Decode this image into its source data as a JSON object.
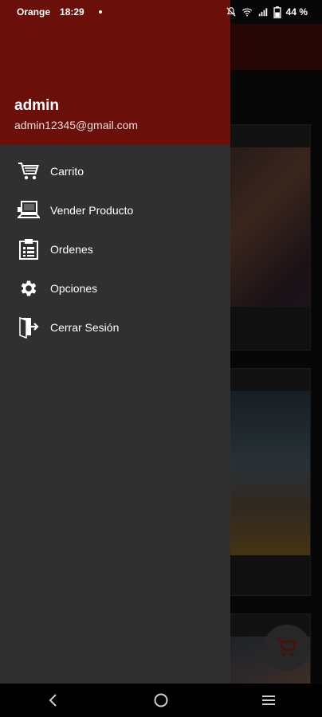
{
  "status_bar": {
    "carrier": "Orange",
    "time": "18:29",
    "battery": "44 %"
  },
  "drawer": {
    "user_name": "admin",
    "user_email": "admin12345@gmail.com",
    "items": [
      {
        "label": "Carrito",
        "icon": "cart-icon"
      },
      {
        "label": "Vender Producto",
        "icon": "laptop-icon"
      },
      {
        "label": "Ordenes",
        "icon": "clipboard-icon"
      },
      {
        "label": "Opciones",
        "icon": "gear-icon"
      },
      {
        "label": "Cerrar Sesión",
        "icon": "logout-icon"
      }
    ]
  },
  "colors": {
    "header_red": "#6b0f0b",
    "drawer_bg": "#303030"
  }
}
